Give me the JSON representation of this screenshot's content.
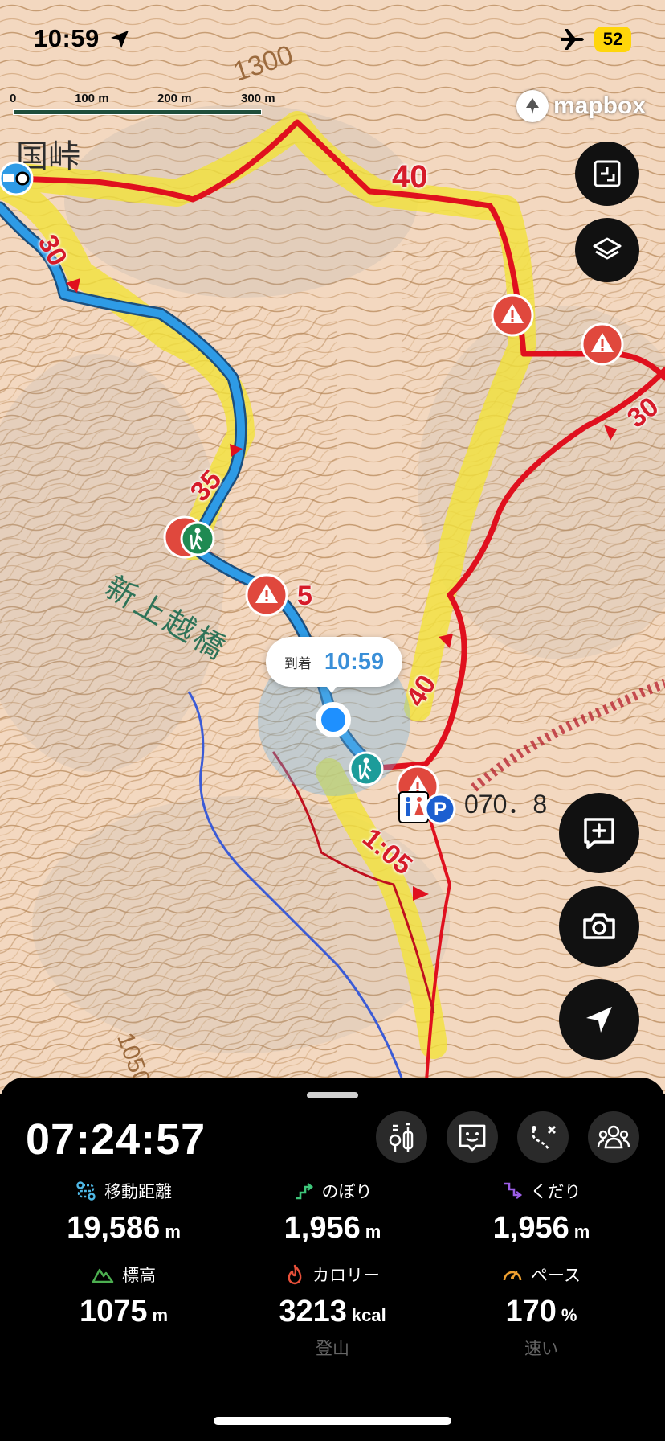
{
  "status_bar": {
    "time": "10:59",
    "battery": "52",
    "location_icon": "location-arrow-icon",
    "airplane_icon": "airplane-icon"
  },
  "map": {
    "scale": {
      "labels": [
        "0",
        "100 m",
        "200 m",
        "300 m"
      ]
    },
    "attribution": "mapbox",
    "pass_name": "国峠",
    "area_name": "新上越橋",
    "contour_labels": [
      "1300",
      "1050"
    ],
    "elevation_point": "070．8",
    "course_times": [
      "40",
      "30",
      "35",
      "5",
      "40",
      "30",
      "1:05"
    ],
    "arrival": {
      "label": "到着",
      "time": "10:59"
    },
    "colors": {
      "route_walked": "#2e9be6",
      "route_planned": "#e0101e",
      "highlight": "#f2e23a",
      "warning": "#e0483d"
    },
    "buttons": [
      "fullscreen-icon",
      "layers-icon",
      "add-memo-icon",
      "camera-icon",
      "locate-icon"
    ]
  },
  "panel": {
    "elapsed": "07:24:57",
    "toolbar_icons": [
      "gear-icon",
      "face-icon",
      "route-icon",
      "group-icon"
    ],
    "stats": [
      {
        "label": "移動距離",
        "value": "19,586",
        "unit": "m",
        "icon": "distance-icon",
        "icon_color": "#4fb8e6"
      },
      {
        "label": "のぼり",
        "value": "1,956",
        "unit": "m",
        "icon": "ascent-icon",
        "icon_color": "#3ec67a"
      },
      {
        "label": "くだり",
        "value": "1,956",
        "unit": "m",
        "icon": "descent-icon",
        "icon_color": "#9b5de5"
      },
      {
        "label": "標高",
        "value": "1075",
        "unit": "m",
        "icon": "elevation-icon",
        "icon_color": "#4caf50"
      },
      {
        "label": "カロリー",
        "value": "3213",
        "unit": "kcal",
        "sub": "登山",
        "icon": "calorie-icon",
        "icon_color": "#e8503a"
      },
      {
        "label": "ペース",
        "value": "170",
        "unit": "%",
        "sub": "速い",
        "icon": "pace-icon",
        "icon_color": "#f0a030"
      }
    ]
  }
}
